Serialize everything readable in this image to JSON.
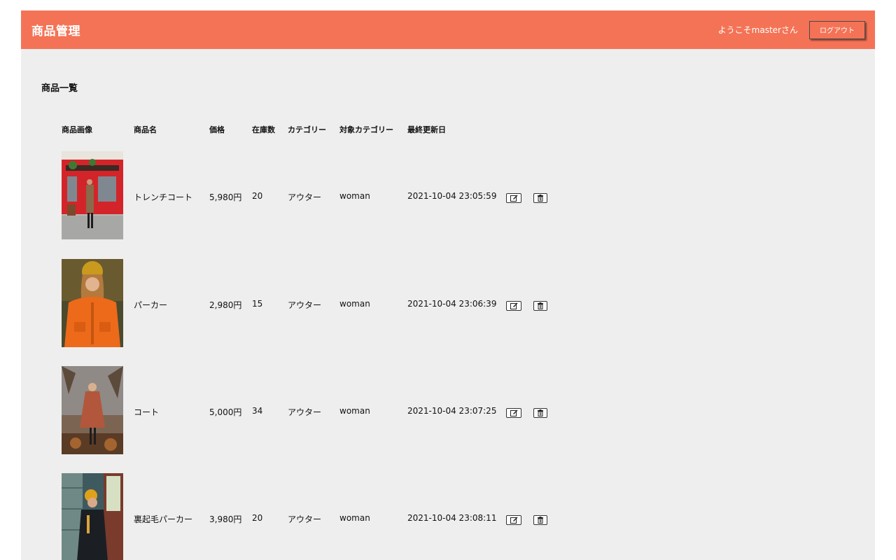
{
  "header": {
    "title": "商品管理",
    "welcome": "ようこそmasterさん",
    "logout_label": "ログアウト"
  },
  "main": {
    "section_title": "商品一覧"
  },
  "table": {
    "headers": [
      "商品画像",
      "商品名",
      "価格",
      "在庫数",
      "カテゴリー",
      "対象カテゴリー",
      "最終更新日"
    ],
    "rows": [
      {
        "name": "トレンチコート",
        "price": "5,980円",
        "stock": "20",
        "category": "アウター",
        "target": "woman",
        "updated": "2021-10-04 23:05:59"
      },
      {
        "name": "パーカー",
        "price": "2,980円",
        "stock": "15",
        "category": "アウター",
        "target": "woman",
        "updated": "2021-10-04 23:06:39"
      },
      {
        "name": "コート",
        "price": "5,000円",
        "stock": "34",
        "category": "アウター",
        "target": "woman",
        "updated": "2021-10-04 23:07:25"
      },
      {
        "name": "裏起毛パーカー",
        "price": "3,980円",
        "stock": "20",
        "category": "アウター",
        "target": "woman",
        "updated": "2021-10-04 23:08:11"
      }
    ]
  },
  "icons": {
    "edit": "edit-icon",
    "delete": "trash-icon"
  },
  "colors": {
    "header_bg": "#f47356",
    "page_bg": "#eeeeee"
  }
}
